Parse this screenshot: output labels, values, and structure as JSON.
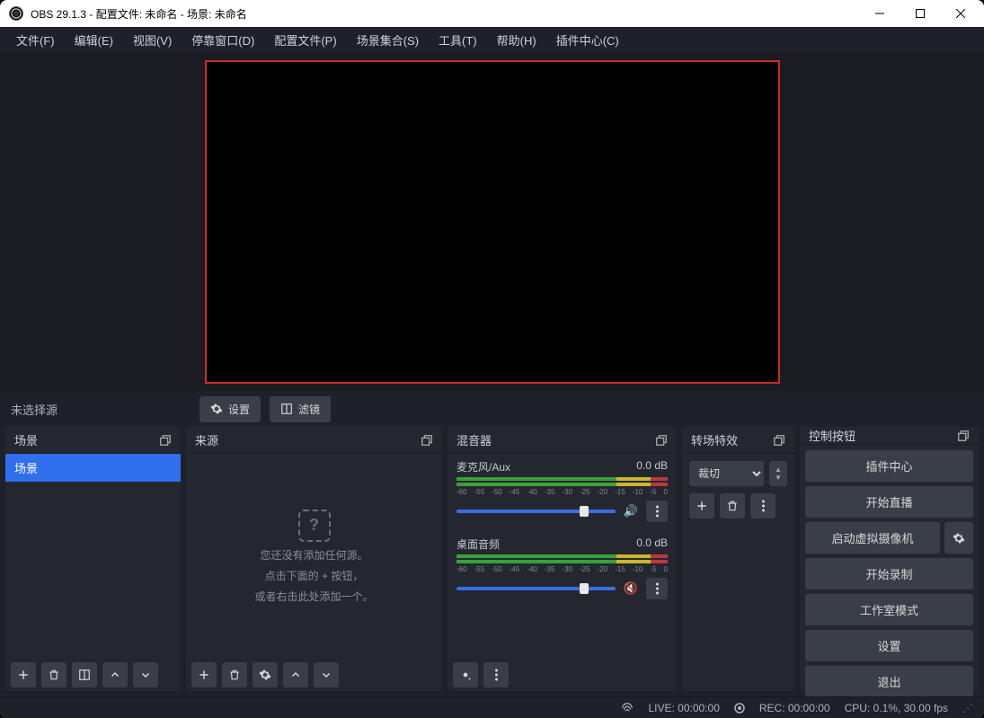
{
  "titlebar": {
    "title": "OBS 29.1.3 - 配置文件: 未命名 - 场景: 未命名"
  },
  "menubar": {
    "items": [
      {
        "label": "文件(F)"
      },
      {
        "label": "编辑(E)"
      },
      {
        "label": "视图(V)"
      },
      {
        "label": "停靠窗口(D)"
      },
      {
        "label": "配置文件(P)"
      },
      {
        "label": "场景集合(S)"
      },
      {
        "label": "工具(T)"
      },
      {
        "label": "帮助(H)"
      },
      {
        "label": "插件中心(C)"
      }
    ]
  },
  "sourcebar": {
    "no_source": "未选择源",
    "settings_label": "设置",
    "filter_label": "滤镜"
  },
  "docks": {
    "scenes": {
      "title": "场景",
      "items": [
        "场景"
      ]
    },
    "sources": {
      "title": "来源",
      "empty_line1": "您还没有添加任何源。",
      "empty_line2": "点击下面的 + 按钮，",
      "empty_line3": "或者右击此处添加一个。"
    },
    "mixer": {
      "title": "混音器",
      "channels": [
        {
          "name": "麦克风/Aux",
          "db": "0.0 dB",
          "muted": false
        },
        {
          "name": "桌面音频",
          "db": "0.0 dB",
          "muted": true
        }
      ],
      "ticks": [
        "-60",
        "-55",
        "-50",
        "-45",
        "-40",
        "-35",
        "-30",
        "-25",
        "-20",
        "-15",
        "-10",
        "-5",
        "0"
      ]
    },
    "transitions": {
      "title": "转场特效",
      "selected": "裁切"
    },
    "controls": {
      "title": "控制按钮",
      "buttons": {
        "plugin_center": "插件中心",
        "start_stream": "开始直播",
        "start_vcam": "启动虚拟摄像机",
        "start_record": "开始录制",
        "studio_mode": "工作室模式",
        "settings": "设置",
        "exit": "退出"
      }
    }
  },
  "statusbar": {
    "live": "LIVE: 00:00:00",
    "rec": "REC: 00:00:00",
    "cpu": "CPU: 0.1%, 30.00 fps"
  }
}
